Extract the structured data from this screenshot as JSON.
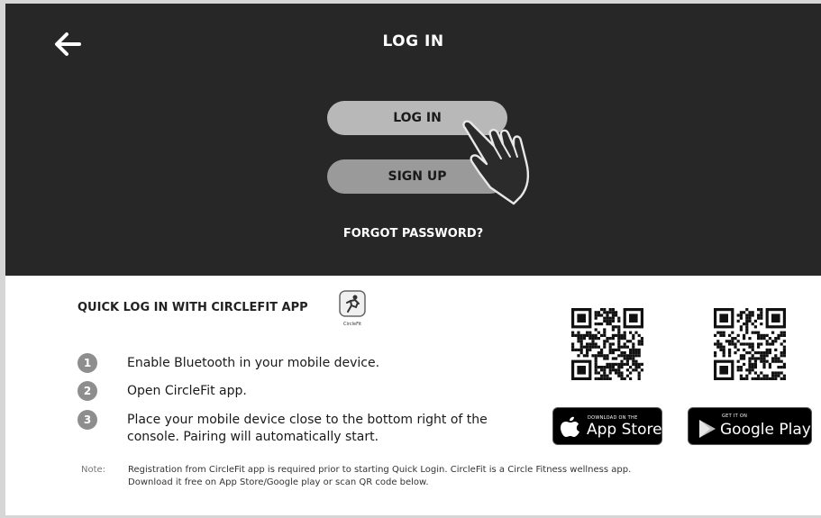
{
  "header": {
    "title": "LOG IN",
    "back_icon": "arrow-left-icon"
  },
  "buttons": {
    "login_label": "LOG IN",
    "signup_label": "SIGN UP",
    "forgot_label": "FORGOT PASSWORD?"
  },
  "quick_login": {
    "title": "QUICK LOG IN WITH CIRCLEFIT APP",
    "app_icon_caption": "CircleFit",
    "steps": [
      {
        "number": "1",
        "text": "Enable Bluetooth in your mobile device."
      },
      {
        "number": "2",
        "text": "Open CircleFit app."
      },
      {
        "number": "3",
        "text_line1": "Place your mobile device close to the bottom right of the",
        "text_line2": "console. Pairing will automatically start."
      }
    ],
    "note_label": "Note:",
    "note_line1": "Registration from CircleFit app is required prior to starting Quick Login. CircleFit is a Circle Fitness wellness app.",
    "note_line2": "Download it free on App Store/Google play or scan QR code below."
  },
  "stores": {
    "app_store_small": "DOWNLOAD ON THE",
    "app_store_big": "App Store",
    "google_small": "GET IT ON",
    "google_big": "Google Play"
  },
  "colors": {
    "top_panel": "#272727",
    "pill": "#a6a6a6",
    "step_circle": "#8e8e8e"
  }
}
